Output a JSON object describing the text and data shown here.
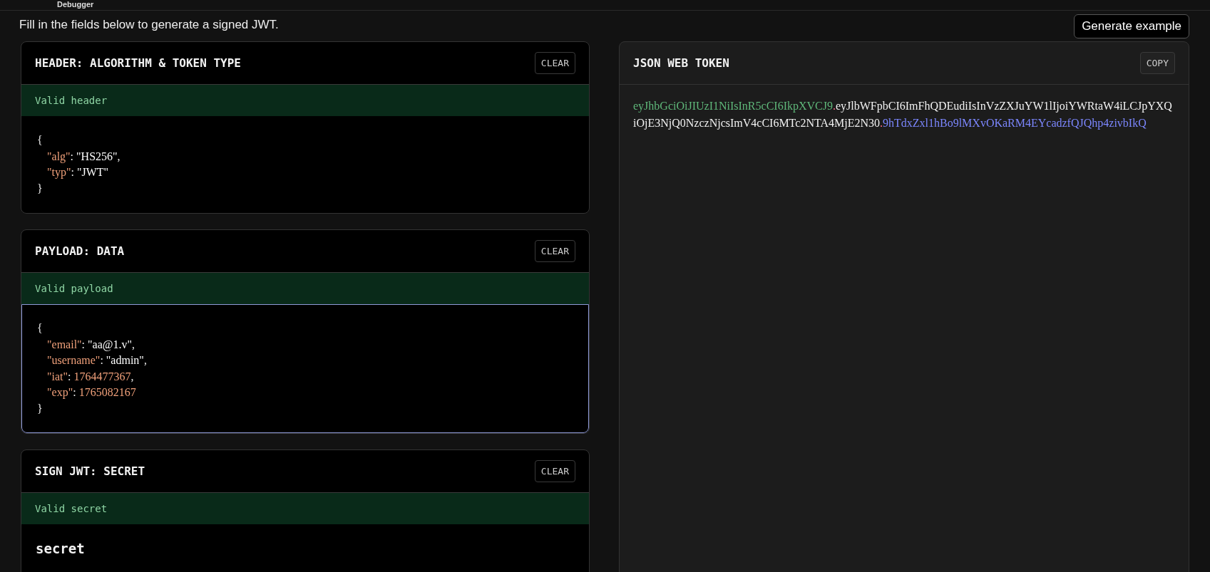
{
  "nav": {
    "label": "Debugger"
  },
  "intro": "Fill in the fields below to generate a signed JWT.",
  "generate_button": "Generate example",
  "panels": [
    {
      "kind": "code",
      "title": "HEADER: ALGORITHM & TOKEN TYPE",
      "clear": "CLEAR",
      "status": {
        "kind": "valid",
        "text": "Valid header"
      },
      "focused": false,
      "code": {
        "open": "{",
        "lines": [
          [
            {
              "kind": "key",
              "t": "\"alg\""
            },
            {
              "kind": "punct",
              "t": ": "
            },
            {
              "kind": "string",
              "t": "\"HS256\""
            },
            {
              "kind": "punct",
              "t": ","
            }
          ],
          [
            {
              "kind": "key",
              "t": "\"typ\""
            },
            {
              "kind": "punct",
              "t": ": "
            },
            {
              "kind": "string",
              "t": "\"JWT\""
            }
          ]
        ],
        "close": "}"
      }
    },
    {
      "kind": "code",
      "title": "PAYLOAD: DATA",
      "clear": "CLEAR",
      "status": {
        "kind": "valid",
        "text": "Valid payload"
      },
      "focused": true,
      "code": {
        "open": "{",
        "lines": [
          [
            {
              "kind": "key",
              "t": "\"email\""
            },
            {
              "kind": "punct",
              "t": ": "
            },
            {
              "kind": "string",
              "t": "\"aa@1.v\""
            },
            {
              "kind": "punct",
              "t": ","
            }
          ],
          [
            {
              "kind": "key",
              "t": "\"username\""
            },
            {
              "kind": "punct",
              "t": ": "
            },
            {
              "kind": "string",
              "t": "\"admin\""
            },
            {
              "kind": "punct",
              "t": ","
            }
          ],
          [
            {
              "kind": "key",
              "t": "\"iat\""
            },
            {
              "kind": "punct",
              "t": ": "
            },
            {
              "kind": "number",
              "t": "1764477367"
            },
            {
              "kind": "punct",
              "t": ","
            }
          ],
          [
            {
              "kind": "key",
              "t": "\"exp\""
            },
            {
              "kind": "punct",
              "t": ": "
            },
            {
              "kind": "number",
              "t": "1765082167"
            }
          ]
        ],
        "close": "}"
      }
    },
    {
      "kind": "secret",
      "title": "SIGN JWT: SECRET",
      "clear": "CLEAR",
      "status": {
        "kind": "valid",
        "text": "Valid secret"
      },
      "value": "secret"
    }
  ],
  "token_panel": {
    "title": "JSON WEB TOKEN",
    "copy": "COPY",
    "segments": [
      {
        "kind": "header",
        "text": "eyJhbGciOiJIUzI1NiIsInR5cCI6IkpXVCJ9"
      },
      {
        "kind": "dot",
        "text": "."
      },
      {
        "kind": "payload",
        "text": "eyJlbWFpbCI6ImFhQDEudiIsInVzZXJuYW1lIjoiYWRtaW4iLCJpYXQiOjE3NjQ0NzczNjcsImV4cCI6MTc2NTA4MjE2N30"
      },
      {
        "kind": "dot",
        "text": "."
      },
      {
        "kind": "signature",
        "text": "9hTdxZxl1hBo9lMXvOKaRM4EYcadzfQJQhp4zivbIkQ"
      }
    ]
  }
}
